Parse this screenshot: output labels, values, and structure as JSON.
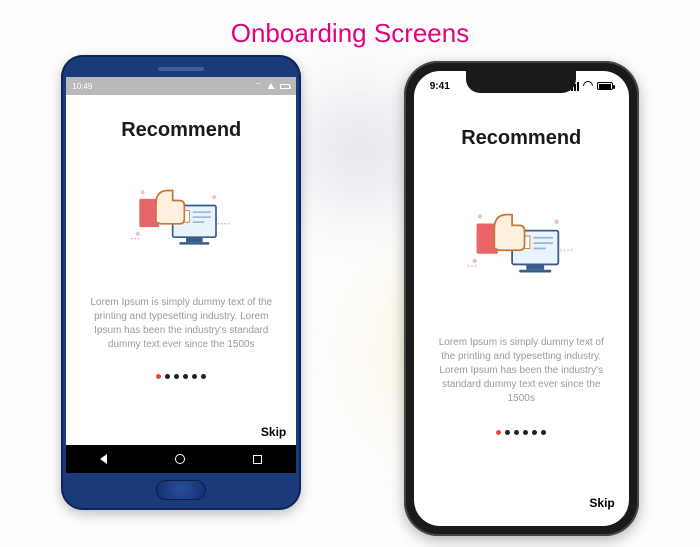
{
  "page_title": "Onboarding Screens",
  "android": {
    "statusbar_time": "10:49",
    "onboarding": {
      "title": "Recommend",
      "description": "Lorem Ipsum is simply dummy text of the printing and typesetting industry. Lorem Ipsum has been the industry's standard dummy text ever since the 1500s",
      "skip_label": "Skip",
      "active_page_index": 0,
      "total_pages": 6
    }
  },
  "iphone": {
    "statusbar_time": "9:41",
    "onboarding": {
      "title": "Recommend",
      "description": "Lorem Ipsum is simply dummy text of the printing and typesetting industry. Lorem Ipsum has been the industry's standard dummy text ever since the 1500s",
      "skip_label": "Skip",
      "active_page_index": 0,
      "total_pages": 6
    }
  },
  "colors": {
    "heading": "#e6007e",
    "dot_active": "#e34b3d"
  }
}
